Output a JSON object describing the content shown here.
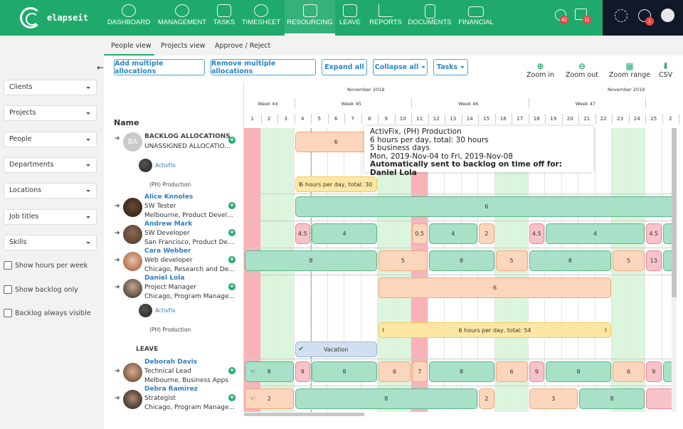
{
  "app": {
    "name": "elapseit"
  },
  "nav": {
    "items": [
      {
        "label": "DASHBOARD",
        "icon": "gauge-icon"
      },
      {
        "label": "MANAGEMENT",
        "icon": "globe-icon"
      },
      {
        "label": "TASKS",
        "icon": "checklist-icon"
      },
      {
        "label": "TIMESHEET",
        "icon": "stopwatch-icon"
      },
      {
        "label": "RESOURCING",
        "icon": "org-chart-icon",
        "active": true
      },
      {
        "label": "LEAVE",
        "icon": "calendar-icon"
      },
      {
        "label": "REPORTS",
        "icon": "chart-up-icon"
      },
      {
        "label": "DOCUMENTS",
        "icon": "document-icon"
      },
      {
        "label": "FINANCIAL",
        "icon": "wallet-icon"
      }
    ],
    "timer_badge": "42",
    "calendar_badge": "11",
    "help_badge": "1"
  },
  "tabs": [
    "People view",
    "Projects view",
    "Approve / Reject"
  ],
  "filters": [
    "Clients",
    "Projects",
    "People",
    "Departments",
    "Locations",
    "Job titles",
    "Skills"
  ],
  "checkboxes": [
    "Show hours per week",
    "Show backlog only",
    "Backlog always visible"
  ],
  "toolbar": {
    "add": "Add multiple allocations",
    "remove": "Remove multiple allocations",
    "expand": "Expand all",
    "collapse": "Collapse all",
    "tasks": "Tasks",
    "zoom_in": "Zoom in",
    "zoom_out": "Zoom out",
    "zoom_range": "Zoom range",
    "csv": "CSV"
  },
  "name_header": "Name",
  "calendar": {
    "month": "November 2019",
    "weeks": [
      {
        "label": "Week 44",
        "start": 1,
        "end": 3
      },
      {
        "label": "Week 45",
        "start": 4,
        "end": 10
      },
      {
        "label": "Week 46",
        "start": 11,
        "end": 17
      },
      {
        "label": "Week 47",
        "start": 18,
        "end": 24
      }
    ],
    "days": [
      "1",
      "2",
      "3",
      "4",
      "5",
      "6",
      "7",
      "8",
      "9",
      "10",
      "11",
      "12",
      "13",
      "14",
      "15",
      "16",
      "17",
      "18",
      "19",
      "20",
      "21",
      "22",
      "23",
      "24",
      "25",
      "2"
    ],
    "weekend_days": [
      2,
      3,
      9,
      10,
      16,
      17,
      23,
      24
    ],
    "holiday_days": [
      1,
      11
    ],
    "today_day": 5
  },
  "rows": [
    {
      "type": "backlog",
      "initials": "BA",
      "name": "BACKLOG ALLOCATIONS",
      "title": "UNASSIGNED ALLOCATIO...",
      "project_client": "ActivFix",
      "project_name": "(PH) Production"
    },
    {
      "type": "person",
      "name": "Alice Knnoles",
      "title": "SW Tester",
      "location": "Melbourne, Product Devel..."
    },
    {
      "type": "person",
      "name": "Andrew Mark",
      "title": "SW Developer",
      "location": "San Francisco, Product De..."
    },
    {
      "type": "person",
      "name": "Cara Webber",
      "title": "Web developer",
      "location": "Chicago, Research and De..."
    },
    {
      "type": "person",
      "name": "Daniel Lola",
      "title": "Project Manager",
      "location": "Chicago, Program Manage...",
      "project_client": "ActivFix",
      "project_name": "(PH) Production"
    },
    {
      "type": "person",
      "name": "Deborah Davis",
      "title": "Technical Lead",
      "location": "Melbourne, Business Apps"
    },
    {
      "type": "person",
      "name": "Debra Ramirez",
      "title": "Strategist",
      "location": "Chicago, Program Manage..."
    }
  ],
  "leave_label": "LEAVE",
  "bars": [
    {
      "row": "backlog",
      "start": 4,
      "end": 8,
      "color": "o",
      "label": "6"
    },
    {
      "row": "backlog-sub",
      "start": 4,
      "end": 8,
      "color": "y",
      "label": "6 hours per day, total: 30"
    },
    {
      "row": "alice",
      "start": 4,
      "end": 26,
      "color": "g",
      "label": "6"
    },
    {
      "row": "andrew",
      "start": 4,
      "end": 4,
      "color": "r",
      "label": "4.5"
    },
    {
      "row": "andrew",
      "start": 5,
      "end": 8,
      "color": "g",
      "label": "4"
    },
    {
      "row": "andrew",
      "start": 11,
      "end": 11,
      "color": "o",
      "label": "0.5"
    },
    {
      "row": "andrew",
      "start": 12,
      "end": 14,
      "color": "g",
      "label": "4"
    },
    {
      "row": "andrew",
      "start": 15,
      "end": 15,
      "color": "o",
      "label": "2"
    },
    {
      "row": "andrew",
      "start": 18,
      "end": 18,
      "color": "r",
      "label": "4.5"
    },
    {
      "row": "andrew",
      "start": 19,
      "end": 24,
      "color": "g",
      "label": "4"
    },
    {
      "row": "andrew",
      "start": 25,
      "end": 25,
      "color": "r",
      "label": "4.5"
    },
    {
      "row": "andrew",
      "start": 26,
      "end": 26,
      "color": "g",
      "label": ""
    },
    {
      "row": "cara",
      "start": 1,
      "end": 8,
      "color": "g",
      "label": "8"
    },
    {
      "row": "cara",
      "start": 9,
      "end": 11,
      "color": "o",
      "label": "5"
    },
    {
      "row": "cara",
      "start": 12,
      "end": 15,
      "color": "g",
      "label": "8"
    },
    {
      "row": "cara",
      "start": 16,
      "end": 17,
      "color": "o",
      "label": "5"
    },
    {
      "row": "cara",
      "start": 18,
      "end": 22,
      "color": "g",
      "label": "8"
    },
    {
      "row": "cara",
      "start": 23,
      "end": 24,
      "color": "o",
      "label": "5"
    },
    {
      "row": "cara",
      "start": 25,
      "end": 25,
      "color": "r",
      "label": "13"
    },
    {
      "row": "cara",
      "start": 26,
      "end": 26,
      "color": "g",
      "label": ""
    },
    {
      "row": "daniel",
      "start": 9,
      "end": 22,
      "color": "o",
      "label": "6"
    },
    {
      "row": "daniel-sub",
      "start": 9,
      "end": 22,
      "color": "y",
      "label": "6 hours per day, total: 54"
    },
    {
      "row": "daniel-leave",
      "start": 4,
      "end": 8,
      "color": "b",
      "label": "Vacation"
    },
    {
      "row": "deborah",
      "start": 1,
      "end": 3,
      "color": "g",
      "label": "8",
      "hand": true
    },
    {
      "row": "deborah",
      "start": 4,
      "end": 4,
      "color": "r",
      "label": "9"
    },
    {
      "row": "deborah",
      "start": 5,
      "end": 8,
      "color": "g",
      "label": "8"
    },
    {
      "row": "deborah",
      "start": 9,
      "end": 10,
      "color": "o",
      "label": "6"
    },
    {
      "row": "deborah",
      "start": 11,
      "end": 11,
      "color": "o",
      "label": "7"
    },
    {
      "row": "deborah",
      "start": 12,
      "end": 15,
      "color": "g",
      "label": "8"
    },
    {
      "row": "deborah",
      "start": 16,
      "end": 17,
      "color": "o",
      "label": "6"
    },
    {
      "row": "deborah",
      "start": 18,
      "end": 18,
      "color": "r",
      "label": "9"
    },
    {
      "row": "deborah",
      "start": 19,
      "end": 22,
      "color": "g",
      "label": "8"
    },
    {
      "row": "deborah",
      "start": 23,
      "end": 24,
      "color": "o",
      "label": "6"
    },
    {
      "row": "deborah",
      "start": 25,
      "end": 25,
      "color": "r",
      "label": "9"
    },
    {
      "row": "deborah",
      "start": 26,
      "end": 26,
      "color": "g",
      "label": ""
    },
    {
      "row": "debra",
      "start": 1,
      "end": 3,
      "color": "o",
      "label": "2",
      "hand": true
    },
    {
      "row": "debra",
      "start": 4,
      "end": 14,
      "color": "g",
      "label": "8"
    },
    {
      "row": "debra",
      "start": 15,
      "end": 15,
      "color": "o",
      "label": "2"
    },
    {
      "row": "debra",
      "start": 18,
      "end": 20,
      "color": "o",
      "label": "3"
    },
    {
      "row": "debra",
      "start": 21,
      "end": 24,
      "color": "g",
      "label": "8"
    },
    {
      "row": "debra",
      "start": 25,
      "end": 26,
      "color": "r",
      "label": ""
    }
  ],
  "tooltip": {
    "line1": "ActivFix, (PH) Production",
    "line2": "6 hours per day, total: 30 hours",
    "line3": "5 business days",
    "line4": "Mon, 2019-Nov-04 to Fri, 2019-Nov-08",
    "line5": "Automatically sent to backlog on time off for: Daniel Lola"
  }
}
